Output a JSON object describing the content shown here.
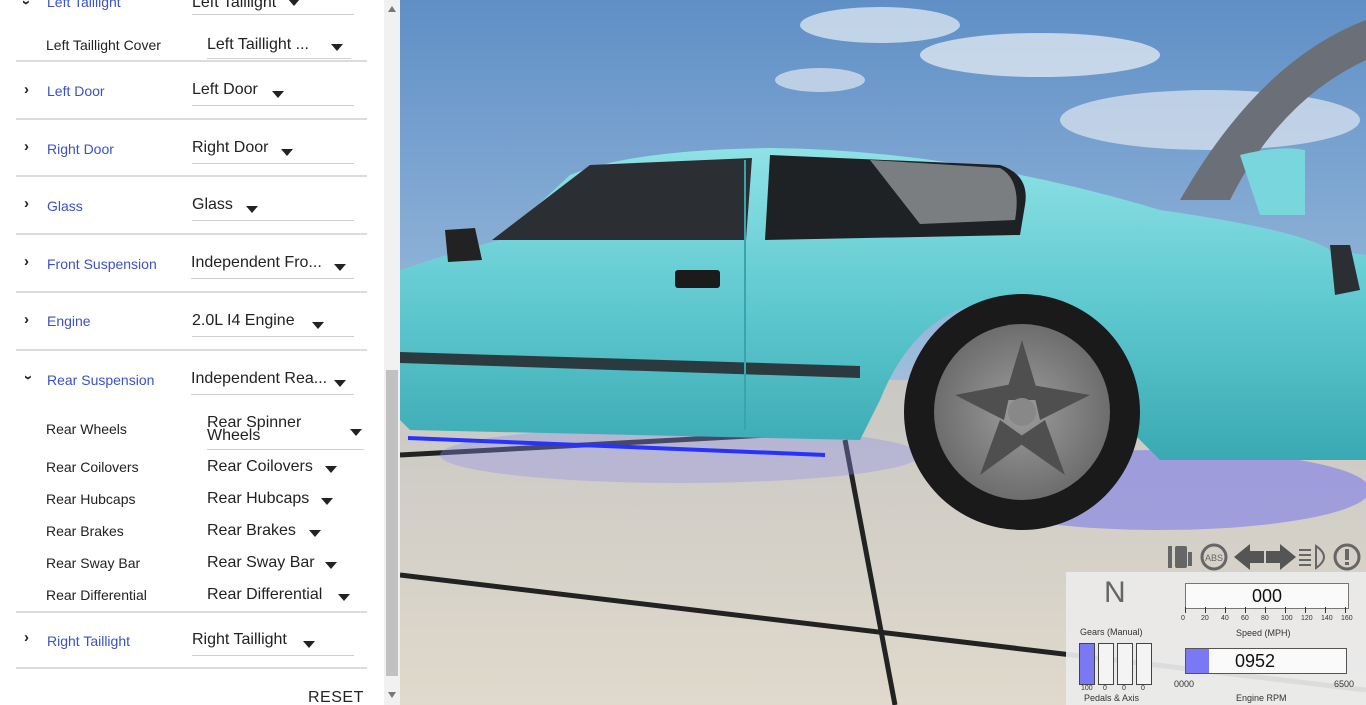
{
  "panel": {
    "top_item": {
      "label": "Left Taillight",
      "value": "Left Taillight"
    },
    "top_sub": {
      "label": "Left Taillight Cover",
      "value": "Left Taillight ..."
    },
    "sections": [
      {
        "label": "Left Door",
        "value": "Left Door"
      },
      {
        "label": "Right Door",
        "value": "Right Door"
      },
      {
        "label": "Glass",
        "value": "Glass"
      },
      {
        "label": "Front Suspension",
        "value": "Independent Fro..."
      },
      {
        "label": "Engine",
        "value": "2.0L I4 Engine"
      },
      {
        "label": "Rear Suspension",
        "value": "Independent Rea..."
      }
    ],
    "rear_sub": [
      {
        "label": "Rear Wheels",
        "value": "Rear Spinner Wheels"
      },
      {
        "label": "Rear Coilovers",
        "value": "Rear Coilovers"
      },
      {
        "label": "Rear Hubcaps",
        "value": "Rear Hubcaps"
      },
      {
        "label": "Rear Brakes",
        "value": "Rear Brakes"
      },
      {
        "label": "Rear Sway Bar",
        "value": "Rear Sway Bar"
      },
      {
        "label": "Rear Differential",
        "value": "Rear Differential"
      }
    ],
    "last_section": {
      "label": "Right Taillight",
      "value": "Right Taillight"
    },
    "reset_label": "RESET"
  },
  "hud": {
    "gear": "N",
    "gears_label": "Gears (Manual)",
    "speed_value": "000",
    "speed_label": "Speed (MPH)",
    "speed_ticks": [
      "0",
      "20",
      "40",
      "60",
      "80",
      "100",
      "120",
      "140",
      "160"
    ],
    "pedals_label": "Pedals & Axis",
    "pedal_values": [
      "100",
      "0",
      "0",
      "0"
    ],
    "pedal_levels": [
      1.0,
      0,
      0,
      0
    ],
    "rpm_value": "0952",
    "rpm_label": "Engine RPM",
    "rpm_min": "0000",
    "rpm_max": "6500",
    "rpm_fraction": 0.146,
    "icons": [
      "fuel-icon",
      "abs-icon",
      "left-signal-icon",
      "right-signal-icon",
      "headlight-icon",
      "warning-icon"
    ],
    "accent": "#7a78f2"
  }
}
